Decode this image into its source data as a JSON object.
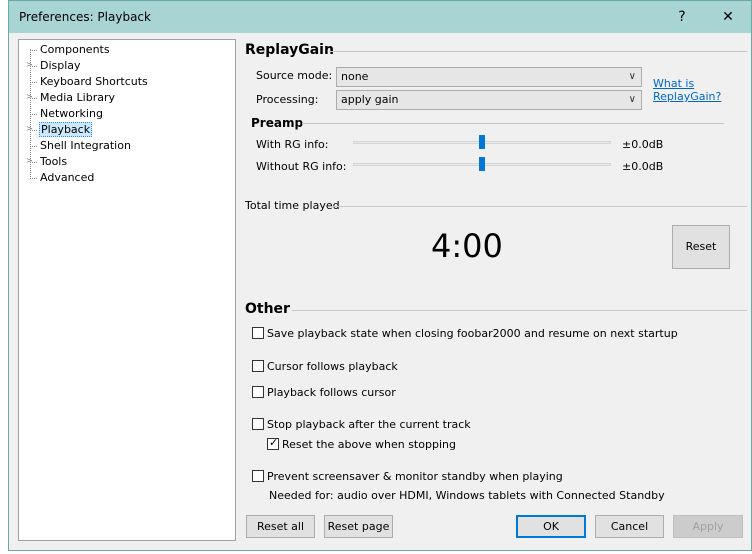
{
  "window": {
    "title": "Preferences: Playback",
    "help_glyph": "?",
    "close_glyph": "✕"
  },
  "tree": {
    "items": [
      {
        "label": "Components",
        "expandable": false,
        "selected": false
      },
      {
        "label": "Display",
        "expandable": true,
        "selected": false
      },
      {
        "label": "Keyboard Shortcuts",
        "expandable": false,
        "selected": false
      },
      {
        "label": "Media Library",
        "expandable": true,
        "selected": false
      },
      {
        "label": "Networking",
        "expandable": false,
        "selected": false
      },
      {
        "label": "Playback",
        "expandable": true,
        "selected": true
      },
      {
        "label": "Shell Integration",
        "expandable": false,
        "selected": false
      },
      {
        "label": "Tools",
        "expandable": true,
        "selected": false
      },
      {
        "label": "Advanced",
        "expandable": false,
        "selected": false
      }
    ],
    "expander_glyph": ">"
  },
  "replaygain": {
    "title": "ReplayGain",
    "source_mode_label": "Source mode:",
    "source_mode_value": "none",
    "processing_label": "Processing:",
    "processing_value": "apply gain",
    "help_link_line1": "What is",
    "help_link_line2": "ReplayGain?",
    "chevron": "∨"
  },
  "preamp": {
    "title": "Preamp",
    "with_rg_label": "With RG info:",
    "with_rg_value": "±0.0dB",
    "with_rg_position": 0.5,
    "without_rg_label": "Without RG info:",
    "without_rg_value": "±0.0dB",
    "without_rg_position": 0.5
  },
  "total_time": {
    "title": "Total time played",
    "value": "4:00",
    "reset_label": "Reset"
  },
  "other": {
    "title": "Other",
    "options": {
      "save_state": {
        "label": "Save playback state when closing foobar2000 and resume on next startup",
        "checked": false
      },
      "cursor_follows": {
        "label": "Cursor follows playback",
        "checked": false
      },
      "playback_follows": {
        "label": "Playback follows cursor",
        "checked": false
      },
      "stop_after": {
        "label": "Stop playback after the current track",
        "checked": false
      },
      "reset_above": {
        "label": "Reset the above when stopping",
        "checked": true
      },
      "prevent_screensaver": {
        "label": "Prevent screensaver & monitor standby when playing",
        "checked": false
      }
    },
    "note": "Needed for: audio over HDMI, Windows tablets with Connected Standby"
  },
  "footer": {
    "reset_all": "Reset all",
    "reset_page": "Reset page",
    "ok": "OK",
    "cancel": "Cancel",
    "apply": "Apply"
  }
}
